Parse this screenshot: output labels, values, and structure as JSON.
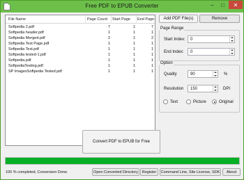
{
  "window": {
    "title": "Free PDF to EPUB Converter"
  },
  "titlebar": {
    "minimize": "–",
    "maximize": "□",
    "close": "✕"
  },
  "filelist": {
    "columns": [
      "File Name",
      "Page Count",
      "Start Page",
      "End Page"
    ],
    "rows": [
      [
        "Softpedia 2.pdf",
        "7",
        "1",
        "7"
      ],
      [
        "Softpedia header.pdf",
        "1",
        "1",
        "1"
      ],
      [
        "Softpedia Merged.pdf",
        "2",
        "1",
        "2"
      ],
      [
        "Softpedia Test Page.pdf",
        "1",
        "1",
        "1"
      ],
      [
        "Softpedia Test.pdf",
        "1",
        "1",
        "1"
      ],
      [
        "Softpedia tested-1.pdf",
        "1",
        "1",
        "1"
      ],
      [
        "Softpedia.pdf",
        "1",
        "1",
        "1"
      ],
      [
        "SoftpediaTesting.pdf",
        "1",
        "1",
        "1"
      ],
      [
        "SP ImagesSoftpedia Tested.pdf",
        "1",
        "1",
        "1"
      ]
    ]
  },
  "buttons": {
    "add": "Add PDF File(s)",
    "remove": "Remove",
    "convert": "Convert PDF to EPUB for Free"
  },
  "page_range": {
    "label": "Page Range",
    "start_label": "Start Index:",
    "start_value": "0",
    "end_label": "End Index:",
    "end_value": "0"
  },
  "option": {
    "label": "Option",
    "quality_label": "Quality",
    "quality_value": "90",
    "quality_unit": "%",
    "resolution_label": "Resolution",
    "resolution_value": "150",
    "resolution_unit": "DPI",
    "modes": [
      "Text",
      "Picture",
      "Original"
    ],
    "selected_mode": "Original"
  },
  "progress": {
    "percent": 100
  },
  "status": {
    "text": "100 % completed, Conversion Done.",
    "open_dir": "Open Converted Directory",
    "register": "Register",
    "command_line": "Command Line, Site License, SDK",
    "about": "About"
  },
  "colors": {
    "titlebar": "#6cc04a",
    "progress": "#06b025",
    "close": "#c74a3c"
  }
}
